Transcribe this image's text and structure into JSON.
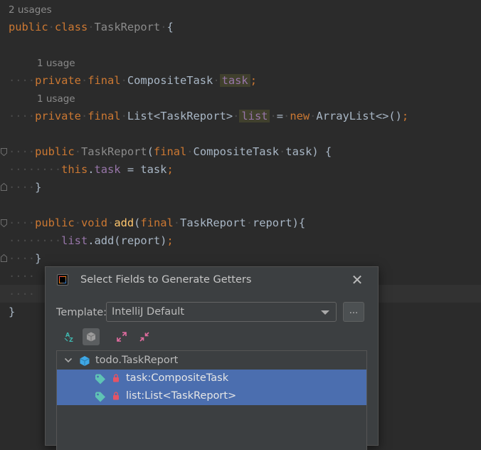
{
  "editor": {
    "usage_hints": {
      "class": "2 usages",
      "task_field": "1 usage",
      "list_field": "1 usage"
    },
    "code": {
      "class_decl": {
        "kw_public": "public",
        "kw_class": "class",
        "name": "TaskReport",
        "brace": "{"
      },
      "field_task": {
        "kw_private": "private",
        "kw_final": "final",
        "type": "CompositeTask",
        "name": "task",
        "semi": ";"
      },
      "field_list": {
        "kw_private": "private",
        "kw_final": "final",
        "type": "List<TaskReport>",
        "name": "list",
        "eq": "=",
        "kw_new": "new",
        "init": "ArrayList<>()",
        "semi": ";"
      },
      "ctor_decl": {
        "kw_public": "public",
        "name": "TaskReport",
        "open": "(",
        "kw_final": "final",
        "type": "CompositeTask",
        "param": "task",
        "close": ") {"
      },
      "ctor_body": {
        "kw_this": "this",
        "dot": ".",
        "field": "task",
        "rest": " = task",
        "semi": ";"
      },
      "ctor_close": "}",
      "add_decl": {
        "kw_public": "public",
        "kw_void": "void",
        "name": "add",
        "open": "(",
        "kw_final": "final",
        "type": "TaskReport",
        "param": "report",
        "close": "){"
      },
      "add_body": {
        "field": "list",
        "rest": ".add(report)",
        "semi": ";"
      },
      "add_close": "}",
      "class_close": "}"
    }
  },
  "dialog": {
    "title": "Select Fields to Generate Getters",
    "close_glyph": "✕",
    "template_label": "Template:",
    "template_value": "IntelliJ Default",
    "more_button": "...",
    "tree": {
      "class_node": "todo.TaskReport",
      "fields": [
        {
          "label": "task:CompositeTask",
          "selected": true
        },
        {
          "label": "list:List<TaskReport>",
          "selected": true
        }
      ]
    },
    "toolbar_icons": [
      "sort-alphabetically-icon",
      "show-classes-icon",
      "expand-all-icon",
      "collapse-all-icon"
    ]
  },
  "colors": {
    "editor_bg": "#2b2b2b",
    "keyword": "#cc7832",
    "field": "#9876aa",
    "method": "#ffc66d",
    "dialog_bg": "#3c3f41",
    "selection": "#4b6eaf"
  }
}
